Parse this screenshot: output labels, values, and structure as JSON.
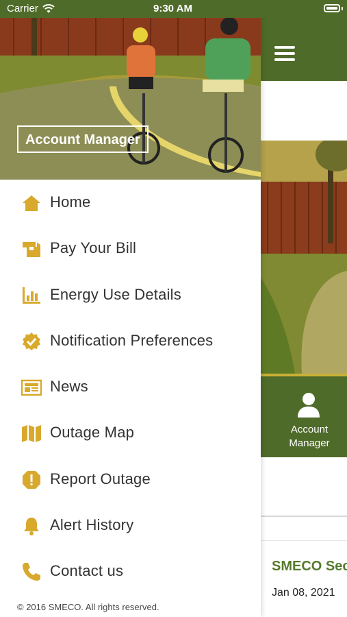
{
  "status_bar": {
    "carrier": "Carrier",
    "time": "9:30 AM"
  },
  "drawer": {
    "header_title": "Account Manager",
    "menu": [
      {
        "label": "Home",
        "icon": "home-icon"
      },
      {
        "label": "Pay Your Bill",
        "icon": "bill-icon"
      },
      {
        "label": "Energy Use Details",
        "icon": "bar-chart-icon"
      },
      {
        "label": "Notification Preferences",
        "icon": "badge-check-icon"
      },
      {
        "label": "News",
        "icon": "newspaper-icon"
      },
      {
        "label": "Outage Map",
        "icon": "map-icon"
      },
      {
        "label": "Report Outage",
        "icon": "warning-icon"
      },
      {
        "label": "Alert History",
        "icon": "bell-icon"
      },
      {
        "label": "Contact us",
        "icon": "phone-icon"
      }
    ],
    "footer": "© 2016 SMECO. All rights reserved."
  },
  "background_screen": {
    "tile_label_line1": "Account",
    "tile_label_line2": "Manager",
    "card_title": "SMECO Sec",
    "card_date": "Jan 08, 2021"
  },
  "colors": {
    "brand_green": "#4f6b2a",
    "icon_gold": "#d8a92c",
    "card_title_green": "#567a2c"
  }
}
